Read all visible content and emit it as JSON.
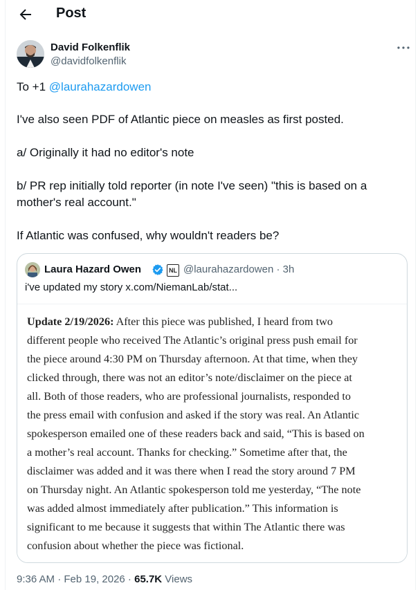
{
  "header": {
    "title": "Post",
    "back_icon": "back-arrow-icon"
  },
  "author": {
    "name": "David Folkenflik",
    "handle": "@davidfolkenflik",
    "more_icon": "more-options-icon"
  },
  "tweet": {
    "line1_prefix": "To +1 ",
    "line1_mention": "@laurahazardowen",
    "para2": "I've also seen PDF of Atlantic piece on measles as first posted.",
    "para3": "a/ Originally it had no editor's note",
    "para4_l1": "b/ PR rep initially told reporter (in note I've seen) \"this is based on a",
    "para4_l2": "mother's real account.\"",
    "para5": "If Atlantic was confused, why wouldn't readers be?"
  },
  "quote": {
    "name": "Laura Hazard Owen",
    "affiliate_badge": "NL",
    "handle_time": "@laurahazardowen · 3h",
    "text": "i've updated my story  x.com/NiemanLab/stat...",
    "image_lines": [
      {
        "bold": "Update 2/19/2026:",
        "rest": " After this piece was published, I heard from two"
      },
      {
        "bold": "",
        "rest": "different people who received The Atlantic’s original press push email for"
      },
      {
        "bold": "",
        "rest": "the piece around 4:30 PM on Thursday afternoon. At that time, when they"
      },
      {
        "bold": "",
        "rest": "clicked through, there was not an editor’s note/disclaimer on the piece at"
      },
      {
        "bold": "",
        "rest": "all. Both of those readers, who are professional journalists, responded to"
      },
      {
        "bold": "",
        "rest": "the press email with confusion and asked if the story was real. An Atlantic"
      },
      {
        "bold": "",
        "rest": "spokesperson emailed one of these readers back and said, “This is based on"
      },
      {
        "bold": "",
        "rest": "a mother’s real account. Thanks for checking.” Sometime after that, the"
      },
      {
        "bold": "",
        "rest": "disclaimer was added and it was there when I read the story around 7 PM"
      },
      {
        "bold": "",
        "rest": "on Thursday night. An Atlantic spokesperson told me yesterday, “The note"
      },
      {
        "bold": "",
        "rest": "was added almost immediately after publication.” This information is"
      },
      {
        "bold": "",
        "rest": "significant to me because it suggests that within The Atlantic there was"
      },
      {
        "bold": "",
        "rest": "confusion about whether the piece was fictional."
      }
    ]
  },
  "footer": {
    "timestamp": "9:36 AM · Feb 19, 2026 · ",
    "views_count": "65.7K",
    "views_label": " Views"
  },
  "colors": {
    "link": "#1d9bf0",
    "muted": "#536471",
    "verified": "#1d9bf0"
  }
}
